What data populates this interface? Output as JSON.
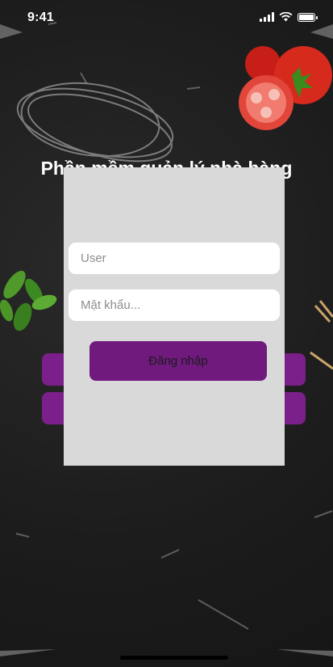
{
  "status_bar": {
    "time": "9:41"
  },
  "background": {
    "headline": "Phần mềm quản lý nhà hàng"
  },
  "login_modal": {
    "user_placeholder": "User",
    "password_placeholder": "Mật khẩu...",
    "login_label": "Đăng nhập"
  },
  "colors": {
    "accent": "#701a7e",
    "modal_bg": "#d9d9d9",
    "background": "#1f1f1f"
  }
}
